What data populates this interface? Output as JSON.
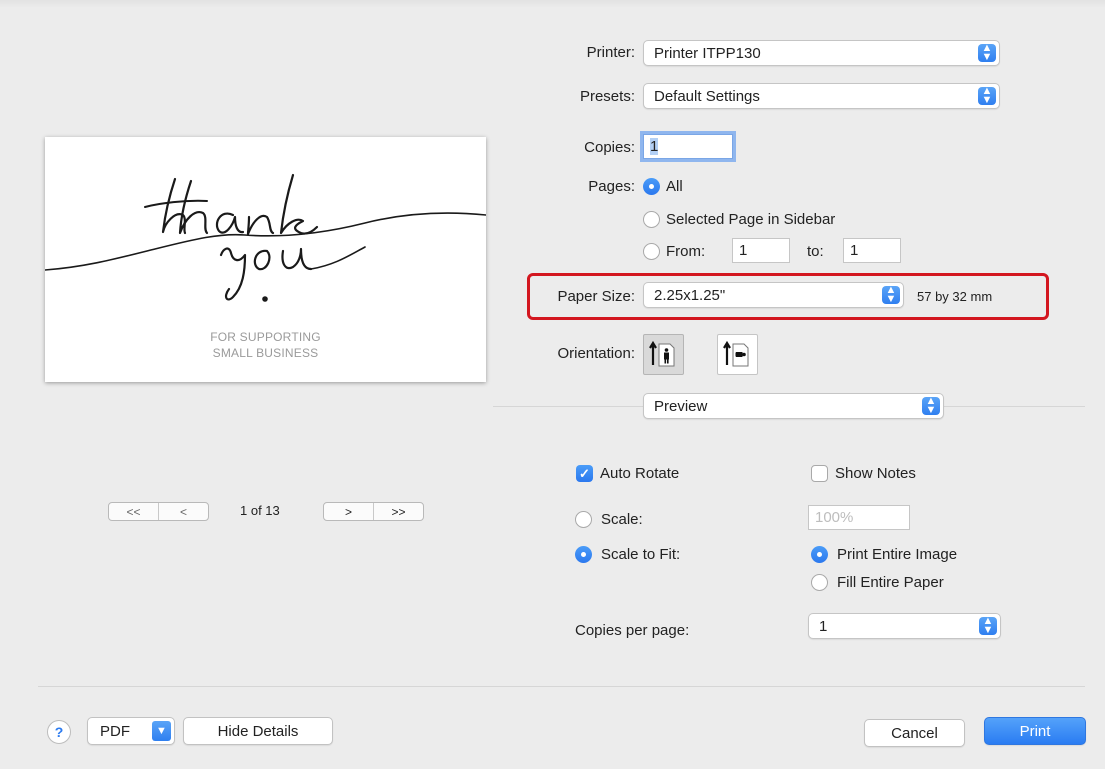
{
  "preview": {
    "card_line1": "FOR SUPPORTING",
    "card_line2": "SMALL BUSINESS",
    "pager": {
      "first": "<<",
      "prev": "<",
      "indicator": "1 of 13",
      "next": ">",
      "last": ">>"
    }
  },
  "printer": {
    "label": "Printer:",
    "value": "Printer ITPP130"
  },
  "presets": {
    "label": "Presets:",
    "value": "Default Settings"
  },
  "copies": {
    "label": "Copies:",
    "value": "1"
  },
  "pages": {
    "label": "Pages:",
    "all": "All",
    "selected": "Selected Page in Sidebar",
    "from_label": "From:",
    "from_value": "1",
    "to_label": "to:",
    "to_value": "1"
  },
  "paper_size": {
    "label": "Paper Size:",
    "value": "2.25x1.25\"",
    "dimensions": "57 by 32 mm"
  },
  "orientation": {
    "label": "Orientation:"
  },
  "section_popup": {
    "value": "Preview"
  },
  "options": {
    "auto_rotate": "Auto Rotate",
    "show_notes": "Show Notes",
    "scale": "Scale:",
    "scale_value": "100%",
    "scale_to_fit": "Scale to Fit:",
    "print_entire_image": "Print Entire Image",
    "fill_entire_paper": "Fill Entire Paper",
    "copies_per_page_label": "Copies per page:",
    "copies_per_page_value": "1"
  },
  "footer": {
    "help": "?",
    "pdf": "PDF",
    "hide_details": "Hide Details",
    "cancel": "Cancel",
    "print": "Print"
  },
  "colors": {
    "accent": "#2f7ff0",
    "highlight": "#d3161f",
    "background": "#ececec"
  }
}
